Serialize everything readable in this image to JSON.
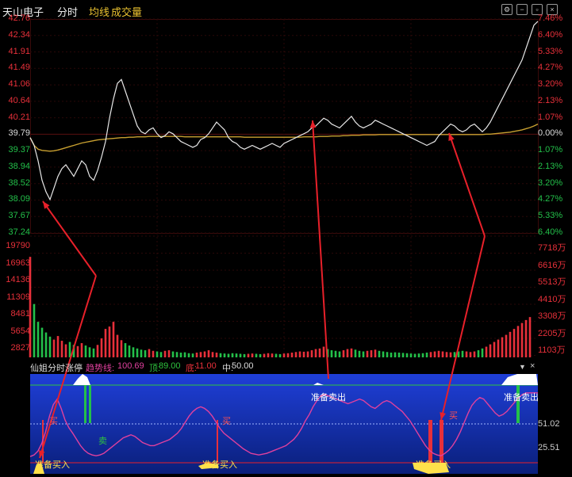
{
  "header": {
    "stock_name": "天山电子",
    "mode": "分时",
    "avg_line": "均线",
    "volume": "成交量",
    "icons": [
      "settings-icon",
      "minus-icon",
      "restore-icon",
      "close-icon"
    ]
  },
  "price_axis_left": [
    "42.76",
    "42.34",
    "41.91",
    "41.49",
    "41.06",
    "40.64",
    "40.21",
    "39.79",
    "39.37",
    "38.94",
    "38.52",
    "38.09",
    "37.67",
    "37.24"
  ],
  "price_axis_right": [
    "7.46%",
    "6.40%",
    "5.33%",
    "4.27%",
    "3.20%",
    "2.13%",
    "1.07%",
    "0.00%",
    "1.07%",
    "2.13%",
    "3.20%",
    "4.27%",
    "5.33%",
    "6.40%"
  ],
  "volume_axis_left": [
    "19790",
    "16963",
    "14136",
    "11309",
    "8481",
    "5654",
    "2827"
  ],
  "volume_axis_right": [
    "7718万",
    "6616万",
    "5513万",
    "4410万",
    "3308万",
    "2205万",
    "1103万"
  ],
  "indicator": {
    "name": "仙姐分时涨停",
    "trend_label": "趋势线:",
    "trend_value": "100.69",
    "top_label": "顶:",
    "top_value": "89.00",
    "bottom_label": "底:",
    "bottom_value": "11.00",
    "mid_label": "中:",
    "mid_value": "50.00",
    "axis": [
      "51.02",
      "25.51"
    ],
    "signals": {
      "prepare_buy": "准备买入",
      "prepare_sell": "准备卖出",
      "buy": "买",
      "sell": "卖"
    }
  },
  "colors": {
    "up": "#e8303a",
    "down": "#23c04a",
    "price_line": "#e8e8e8",
    "avg_line": "#c8a030",
    "indicator_line": "#e0409e",
    "indicator_bg_top": "#1f3fd8",
    "indicator_bg_bottom": "#0a1f7a",
    "annotation_arrow": "#e8202a"
  },
  "chart_data": {
    "type": "line",
    "series": [],
    "ylim": [
      37.24,
      42.76
    ],
    "prev_close": 39.79,
    "price": [
      39.7,
      39.5,
      39.1,
      38.6,
      38.3,
      38.1,
      38.4,
      38.7,
      38.9,
      39.0,
      38.85,
      38.7,
      38.9,
      39.1,
      39.0,
      38.7,
      38.6,
      38.85,
      39.2,
      39.6,
      40.2,
      40.7,
      41.1,
      41.2,
      40.9,
      40.6,
      40.3,
      40.0,
      39.85,
      39.8,
      39.9,
      39.95,
      39.8,
      39.7,
      39.75,
      39.85,
      39.8,
      39.7,
      39.6,
      39.55,
      39.5,
      39.45,
      39.5,
      39.65,
      39.7,
      39.8,
      39.95,
      40.1,
      40.0,
      39.9,
      39.7,
      39.6,
      39.55,
      39.45,
      39.4,
      39.45,
      39.5,
      39.45,
      39.4,
      39.45,
      39.5,
      39.55,
      39.5,
      39.45,
      39.55,
      39.6,
      39.65,
      39.7,
      39.75,
      39.8,
      39.85,
      39.95,
      40.0,
      40.1,
      40.2,
      40.15,
      40.05,
      40.0,
      39.95,
      40.05,
      40.15,
      40.25,
      40.1,
      40.0,
      39.95,
      40.0,
      40.05,
      40.15,
      40.1,
      40.05,
      40.0,
      39.95,
      39.9,
      39.85,
      39.8,
      39.75,
      39.7,
      39.65,
      39.6,
      39.55,
      39.5,
      39.55,
      39.6,
      39.75,
      39.85,
      39.95,
      40.05,
      40.0,
      39.9,
      39.85,
      39.9,
      40.0,
      40.05,
      39.95,
      39.85,
      39.95,
      40.1,
      40.3,
      40.5,
      40.7,
      40.9,
      41.1,
      41.3,
      41.5,
      41.7,
      42.0,
      42.3,
      42.6,
      42.7
    ],
    "avg": [
      39.7,
      39.5,
      39.4,
      39.37,
      39.36,
      39.35,
      39.36,
      39.38,
      39.41,
      39.44,
      39.47,
      39.5,
      39.53,
      39.56,
      39.58,
      39.6,
      39.62,
      39.64,
      39.65,
      39.66,
      39.67,
      39.68,
      39.69,
      39.7,
      39.7,
      39.71,
      39.71,
      39.72,
      39.72,
      39.72,
      39.73,
      39.73,
      39.73,
      39.73,
      39.73,
      39.73,
      39.73,
      39.73,
      39.73,
      39.72,
      39.72,
      39.72,
      39.72,
      39.72,
      39.72,
      39.72,
      39.72,
      39.72,
      39.72,
      39.72,
      39.72,
      39.72,
      39.72,
      39.72,
      39.71,
      39.71,
      39.71,
      39.71,
      39.71,
      39.71,
      39.71,
      39.71,
      39.71,
      39.71,
      39.71,
      39.71,
      39.71,
      39.71,
      39.71,
      39.72,
      39.72,
      39.72,
      39.72,
      39.73,
      39.73,
      39.73,
      39.74,
      39.74,
      39.74,
      39.75,
      39.75,
      39.76,
      39.76,
      39.76,
      39.77,
      39.77,
      39.77,
      39.77,
      39.78,
      39.78,
      39.78,
      39.78,
      39.78,
      39.78,
      39.78,
      39.78,
      39.78,
      39.78,
      39.78,
      39.78,
      39.78,
      39.78,
      39.78,
      39.78,
      39.78,
      39.78,
      39.78,
      39.78,
      39.78,
      39.78,
      39.78,
      39.78,
      39.78,
      39.78,
      39.78,
      39.79,
      39.79,
      39.8,
      39.81,
      39.82,
      39.83,
      39.84,
      39.86,
      39.88,
      39.9,
      39.93,
      39.96,
      40.0,
      40.05
    ],
    "volume": [
      16963,
      9000,
      6000,
      5000,
      4200,
      3500,
      3000,
      3600,
      2800,
      2200,
      2600,
      2100,
      1900,
      2400,
      2000,
      1700,
      1500,
      2100,
      3200,
      4800,
      5200,
      6000,
      3800,
      2900,
      2400,
      2000,
      1700,
      1500,
      1300,
      1200,
      1400,
      1100,
      1000,
      900,
      1100,
      1200,
      1000,
      900,
      800,
      850,
      700,
      650,
      800,
      900,
      1000,
      1200,
      900,
      800,
      700,
      650,
      600,
      700,
      650,
      600,
      550,
      600,
      650,
      600,
      550,
      600,
      700,
      650,
      600,
      550,
      650,
      700,
      800,
      900,
      1000,
      950,
      1000,
      1200,
      1400,
      1500,
      1800,
      1400,
      1200,
      1100,
      1000,
      1200,
      1400,
      1500,
      1300,
      1100,
      1000,
      1100,
      1200,
      1300,
      1100,
      1000,
      900,
      800,
      850,
      800,
      750,
      700,
      650,
      600,
      650,
      700,
      800,
      900,
      1000,
      1100,
      1000,
      900,
      850,
      900,
      1000,
      1100,
      1000,
      900,
      1000,
      1200,
      1500,
      1800,
      2200,
      2600,
      3000,
      3400,
      3800,
      4300,
      4800,
      5300,
      5800,
      6300,
      6800
    ],
    "indicator_values": [
      8,
      10,
      15,
      25,
      40,
      60,
      75,
      82,
      70,
      55,
      45,
      38,
      30,
      22,
      16,
      12,
      10,
      9,
      10,
      12,
      16,
      20,
      24,
      28,
      32,
      34,
      36,
      34,
      30,
      26,
      24,
      22,
      22,
      24,
      26,
      28,
      30,
      34,
      38,
      44,
      52,
      60,
      66,
      70,
      72,
      70,
      66,
      60,
      52,
      44,
      38,
      34,
      30,
      26,
      22,
      18,
      15,
      12,
      11,
      10,
      11,
      12,
      14,
      16,
      18,
      20,
      22,
      26,
      30,
      36,
      44,
      54,
      62,
      72,
      80,
      86,
      88,
      86,
      84,
      82,
      80,
      78,
      76,
      78,
      80,
      82,
      80,
      76,
      72,
      70,
      74,
      78,
      80,
      78,
      74,
      70,
      66,
      60,
      54,
      46,
      38,
      30,
      22,
      16,
      12,
      10,
      9,
      12,
      16,
      22,
      30,
      40,
      52,
      64,
      74,
      80,
      84,
      82,
      76,
      70,
      64,
      60,
      62,
      66,
      72,
      78,
      84,
      88,
      90,
      90,
      90,
      90
    ]
  }
}
